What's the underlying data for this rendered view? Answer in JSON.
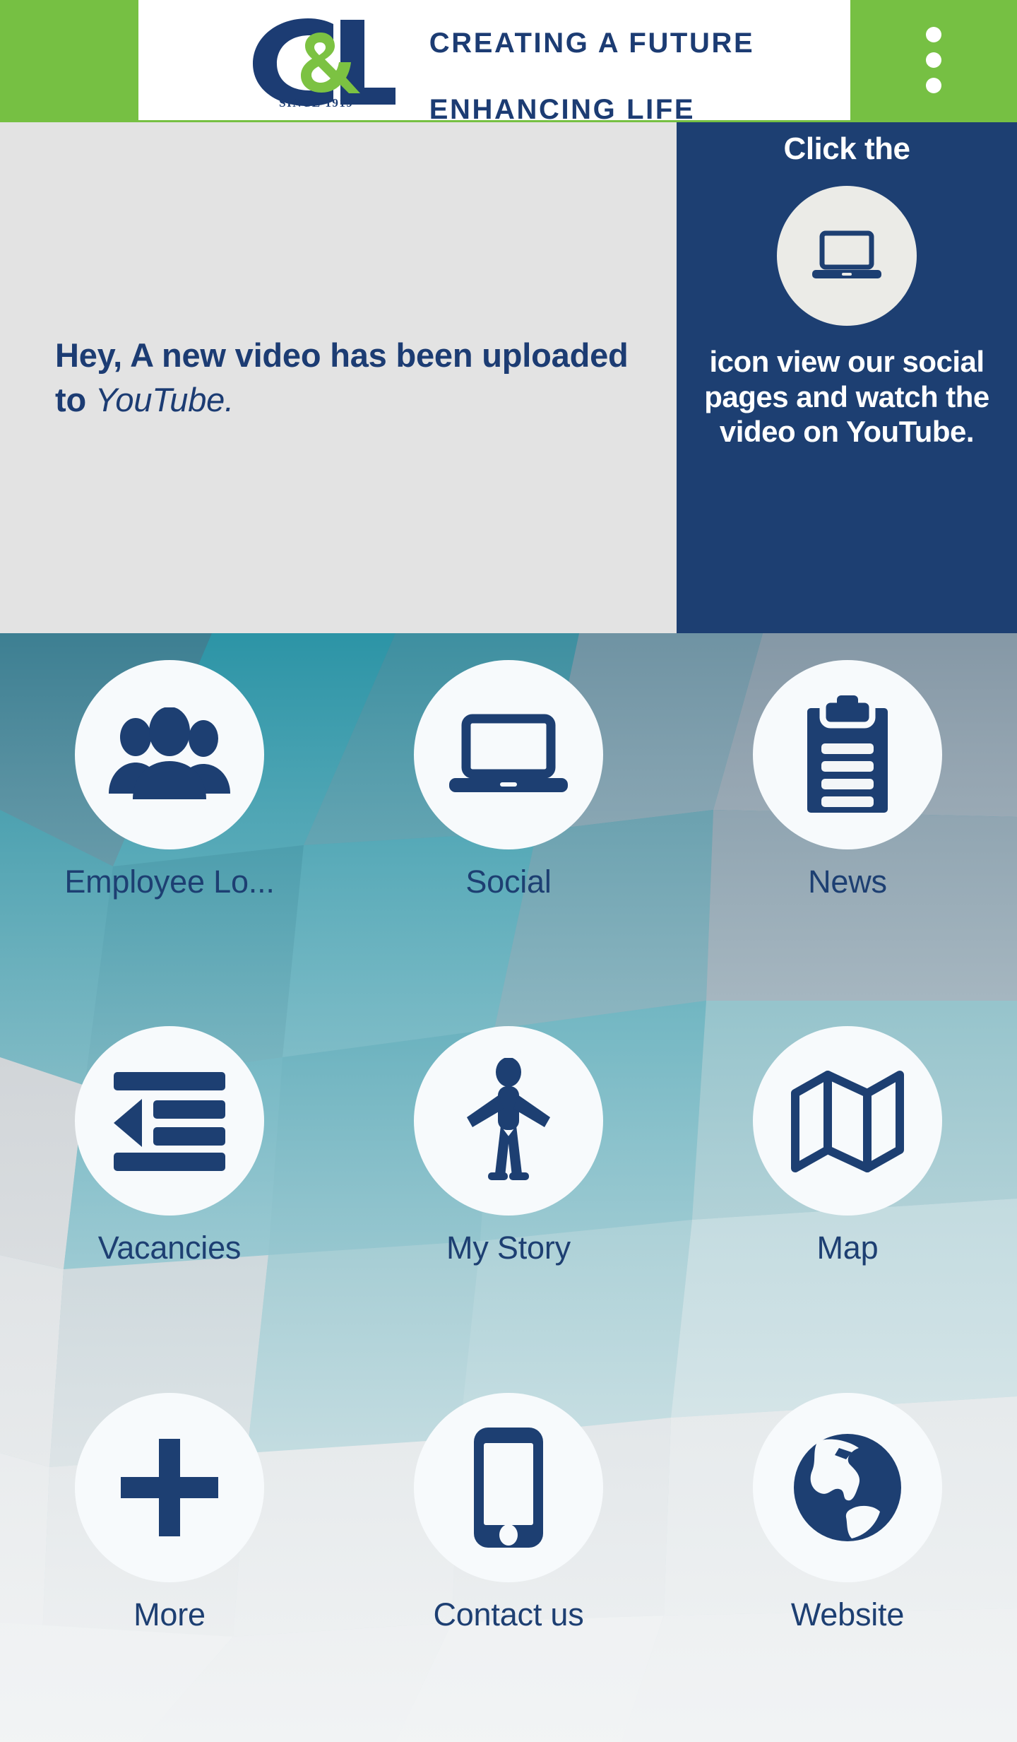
{
  "theme": {
    "brand_green": "#76C043",
    "brand_navy": "#1d3f72",
    "banner_gray": "#e3e3e3",
    "circle_white": "#f7fafc"
  },
  "header": {
    "logo_text": "C&L",
    "logo_since": "SINCE 1919",
    "tagline_line1": "CREATING A FUTURE",
    "tagline_line2": "ENHANCING LIFE",
    "overflow_icon": "overflow-menu-icon"
  },
  "banner": {
    "message_prefix": "Hey, A new video has been uploaded to ",
    "message_brand": "YouTube.",
    "dots": [
      {
        "active": false
      },
      {
        "active": true
      },
      {
        "active": false
      }
    ],
    "promo": {
      "top_text": "Click the",
      "icon": "laptop-icon",
      "bottom_text": "icon view our social pages and watch the video on YouTube."
    }
  },
  "grid": {
    "tiles": [
      {
        "label": "Employee Lo...",
        "icon": "people-group-icon"
      },
      {
        "label": "Social",
        "icon": "laptop-icon"
      },
      {
        "label": "News",
        "icon": "clipboard-icon"
      },
      {
        "label": "Vacancies",
        "icon": "indent-decrease-icon"
      },
      {
        "label": "My Story",
        "icon": "person-standing-icon"
      },
      {
        "label": "Map",
        "icon": "folded-map-icon"
      },
      {
        "label": "More",
        "icon": "plus-icon"
      },
      {
        "label": "Contact us",
        "icon": "mobile-phone-icon"
      },
      {
        "label": "Website",
        "icon": "globe-icon"
      }
    ]
  }
}
